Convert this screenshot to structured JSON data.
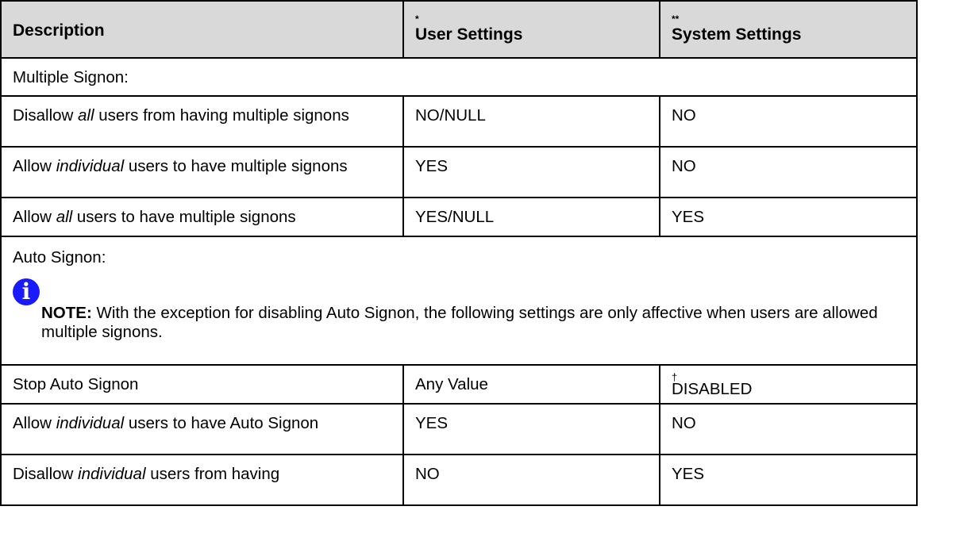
{
  "table": {
    "headers": {
      "description": "Description",
      "user_settings_mark": "*",
      "user_settings": "User Settings",
      "system_settings_mark": "**",
      "system_settings": "System Settings"
    },
    "sections": {
      "multiple_signon": "Multiple Signon:",
      "auto_signon": "Auto Signon:"
    },
    "rows": [
      {
        "pre": "Disallow ",
        "em": "all",
        "post": " users from having multiple signons",
        "user": "NO/NULL",
        "system": "NO"
      },
      {
        "pre": "Allow ",
        "em": "individual",
        "post": " users to have multiple signons",
        "user": "YES",
        "system": "NO"
      },
      {
        "pre": "Allow ",
        "em": "all",
        "post": " users to have multiple signons",
        "user": "YES/NULL",
        "system": "YES"
      },
      {
        "pre": "Stop Auto Signon",
        "em": "",
        "post": "",
        "user": "Any Value",
        "system_mark": "†",
        "system": "DISABLED"
      },
      {
        "pre": "Allow ",
        "em": "individual",
        "post": " users to have Auto Signon",
        "user": "YES",
        "system": "NO"
      },
      {
        "pre": "Disallow ",
        "em": "individual",
        "post": " users from having",
        "user": "NO",
        "system": "YES"
      }
    ],
    "note": {
      "icon": "info-icon",
      "icon_glyph": "i",
      "label": "NOTE:",
      "text": " With the exception for disabling Auto Signon, the following settings are only affective when users are allowed multiple signons."
    }
  },
  "colors": {
    "header_bg": "#d9d9d9",
    "border": "#000000",
    "info_icon": "#1a1aff"
  }
}
